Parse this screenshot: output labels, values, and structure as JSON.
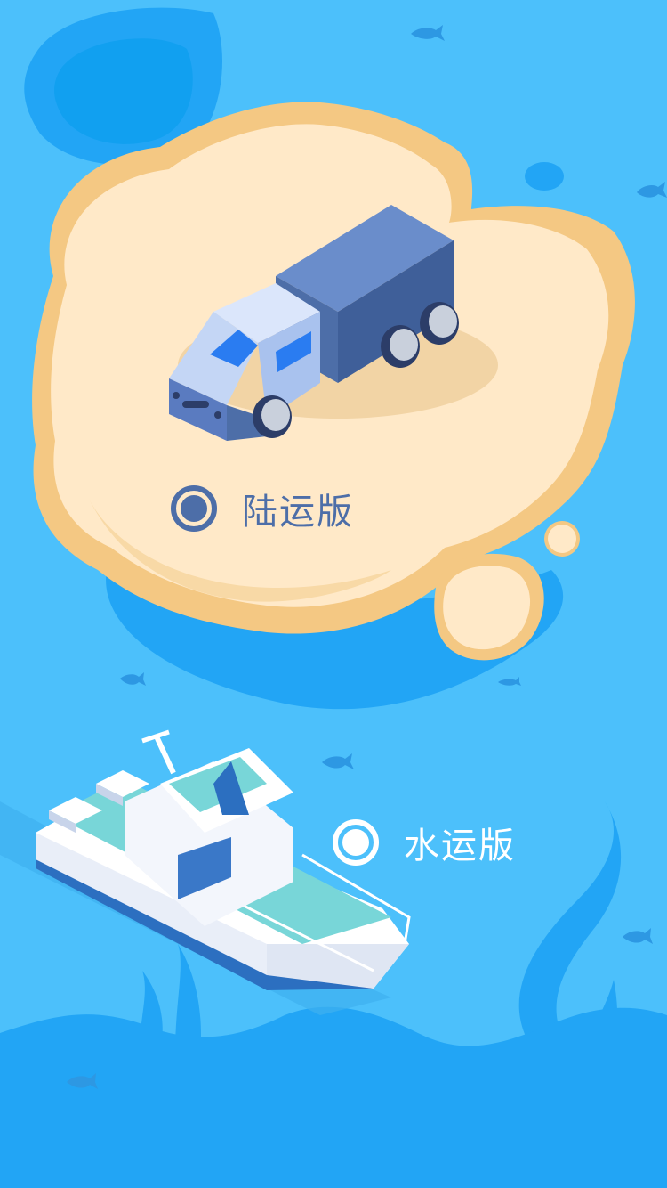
{
  "options": {
    "land": {
      "label": "陆运版",
      "selected": true
    },
    "water": {
      "label": "水运版",
      "selected": false
    }
  },
  "colors": {
    "sea": "#4cc0fb",
    "island": "#ffe9c8",
    "island_shadow": "#f4c883",
    "accent": "#4d6ea8",
    "white": "#ffffff"
  }
}
